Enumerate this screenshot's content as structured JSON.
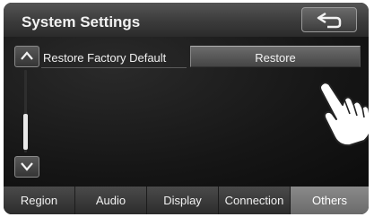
{
  "header": {
    "title": "System Settings",
    "back_icon": "return-arrow-icon"
  },
  "settings": {
    "rows": [
      {
        "label": "Restore Factory Default",
        "button_label": "Restore"
      }
    ],
    "scroll_level": 0.35
  },
  "tabs": [
    {
      "label": "Region",
      "active": false
    },
    {
      "label": "Audio",
      "active": false
    },
    {
      "label": "Display",
      "active": false
    },
    {
      "label": "Connection",
      "active": false
    },
    {
      "label": "Others",
      "active": true
    }
  ],
  "colors": {
    "screen_bg": "#111111",
    "active_tab": "#7a7a7a"
  }
}
